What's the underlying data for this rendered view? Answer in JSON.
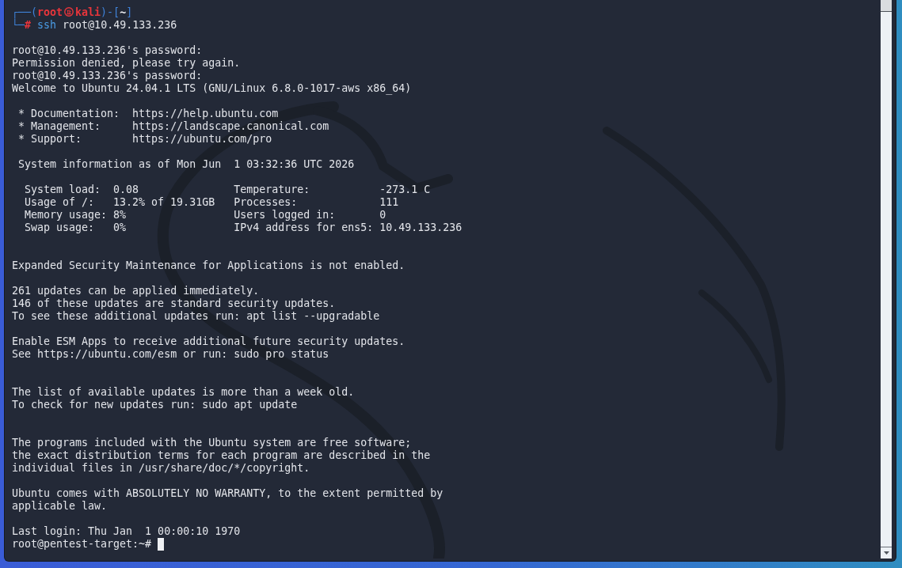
{
  "terminal": {
    "prompt": {
      "open": "┌──(",
      "user": "root",
      "host": "kali",
      "middle": ")-[",
      "directory": "~",
      "close": "]",
      "corner": "└─",
      "symbol": "#",
      "command": "ssh",
      "argument": "root@10.49.133.236"
    },
    "output": [
      {
        "kind": "blank"
      },
      {
        "kind": "text",
        "text": "root@10.49.133.236's password:"
      },
      {
        "kind": "text",
        "text": "Permission denied, please try again."
      },
      {
        "kind": "text",
        "text": "root@10.49.133.236's password:"
      },
      {
        "kind": "text",
        "text": "Welcome to Ubuntu 24.04.1 LTS (GNU/Linux 6.8.0-1017-aws x86_64)"
      },
      {
        "kind": "blank"
      },
      {
        "kind": "link",
        "label": "* Documentation:",
        "url": "https://help.ubuntu.com"
      },
      {
        "kind": "link",
        "label": "* Management:",
        "url": "https://landscape.canonical.com"
      },
      {
        "kind": "link",
        "label": "* Support:",
        "url": "https://ubuntu.com/pro"
      },
      {
        "kind": "blank"
      },
      {
        "kind": "heading",
        "text": "System information as of Mon Jun  1 03:32:36 UTC 2026"
      },
      {
        "kind": "blank"
      },
      {
        "kind": "stats",
        "cells": [
          {
            "label": "System load:",
            "value": "0.08"
          },
          {
            "label": "Temperature:",
            "value": "-273.1 C"
          }
        ]
      },
      {
        "kind": "stats",
        "cells": [
          {
            "label": "Usage of /:",
            "value": "13.2% of 19.31GB"
          },
          {
            "label": "Processes:",
            "value": "111"
          }
        ]
      },
      {
        "kind": "stats",
        "cells": [
          {
            "label": "Memory usage:",
            "value": "8%"
          },
          {
            "label": "Users logged in:",
            "value": "0"
          }
        ]
      },
      {
        "kind": "stats",
        "cells": [
          {
            "label": "Swap usage:",
            "value": "0%"
          },
          {
            "label": "IPv4 address for ens5:",
            "value": "10.49.133.236"
          }
        ]
      },
      {
        "kind": "blank"
      },
      {
        "kind": "blank"
      },
      {
        "kind": "text",
        "text": "Expanded Security Maintenance for Applications is not enabled."
      },
      {
        "kind": "blank"
      },
      {
        "kind": "text",
        "text": "261 updates can be applied immediately."
      },
      {
        "kind": "text",
        "text": "146 of these updates are standard security updates."
      },
      {
        "kind": "text",
        "text": "To see these additional updates run: apt list --upgradable"
      },
      {
        "kind": "blank"
      },
      {
        "kind": "text",
        "text": "Enable ESM Apps to receive additional future security updates."
      },
      {
        "kind": "text",
        "text": "See https://ubuntu.com/esm or run: sudo pro status"
      },
      {
        "kind": "blank"
      },
      {
        "kind": "blank"
      },
      {
        "kind": "text",
        "text": "The list of available updates is more than a week old."
      },
      {
        "kind": "text",
        "text": "To check for new updates run: sudo apt update"
      },
      {
        "kind": "blank"
      },
      {
        "kind": "blank"
      },
      {
        "kind": "text",
        "text": "The programs included with the Ubuntu system are free software;"
      },
      {
        "kind": "text",
        "text": "the exact distribution terms for each program are described in the"
      },
      {
        "kind": "text",
        "text": "individual files in /usr/share/doc/*/copyright."
      },
      {
        "kind": "blank"
      },
      {
        "kind": "text",
        "text": "Ubuntu comes with ABSOLUTELY NO WARRANTY, to the extent permitted by"
      },
      {
        "kind": "text",
        "text": "applicable law."
      },
      {
        "kind": "blank"
      },
      {
        "kind": "text",
        "text": "Last login: Thu Jan  1 00:00:10 1970"
      },
      {
        "kind": "shell",
        "prompt": "root@pentest-target:~#",
        "cursor": true
      }
    ]
  }
}
